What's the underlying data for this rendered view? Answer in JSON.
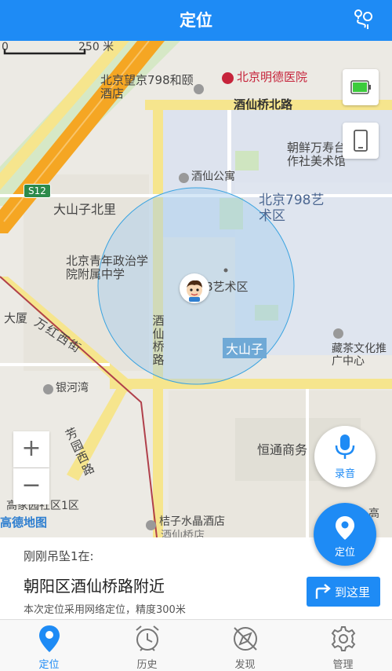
{
  "header": {
    "title": "定位",
    "route_icon": "route-pin-icon"
  },
  "map": {
    "scale_bar_label": "250 米",
    "scale_zero": "0",
    "labels": {
      "hotel_798": "北京望京798和颐酒店",
      "hospital": "北京明德医院",
      "jiuxianqiao_north_rd": "酒仙桥北路",
      "chaoxian_art": "朝鲜万寿台创作社美术馆",
      "jiuxian_apartment": "酒仙公寓",
      "s12": "S12",
      "dashanzi_north": "大山子北里",
      "art_798": "北京798艺术区",
      "art_798_partial": "8艺术区",
      "youth_college": "北京青年政治学院附属中学",
      "dasha": "大厦",
      "wanhong_west": "万红西街",
      "jiuxianqiao_rd": "酒仙桥路",
      "dashanzi": "大山子",
      "cang_cha": "藏茶文化推广中心",
      "yinhewan": "银河湾",
      "fangyuan_west": "芳园西路",
      "hengtong": "恒通商务",
      "gaojia_garden": "高家园社区1区",
      "gaode": "高德地图",
      "juzi_hotel": "桔子水晶酒店",
      "juzi_sub": "酒仙桥店",
      "gao_partial": "高"
    },
    "zoom_in": "+",
    "zoom_out": "−",
    "battery_icon": "battery-icon",
    "phone_icon": "phone-icon"
  },
  "record_button": {
    "label": "录音",
    "icon": "microphone-icon"
  },
  "locate_button": {
    "label": "定位",
    "icon": "location-pin-icon"
  },
  "panel": {
    "status": "刚刚吊坠1在:",
    "address": "朝阳区酒仙桥路附近",
    "note": "本次定位采用网络定位，精度300米",
    "goto_label": "到这里"
  },
  "tabs": [
    {
      "label": "定位",
      "icon": "location-pin-icon",
      "active": true
    },
    {
      "label": "历史",
      "icon": "alarm-clock-icon",
      "active": false
    },
    {
      "label": "发现",
      "icon": "compass-icon",
      "active": false
    },
    {
      "label": "管理",
      "icon": "gear-icon",
      "active": false
    }
  ],
  "colors": {
    "accent": "#1e8bf5",
    "major_road": "#f5a623",
    "road_yellow": "#f6e58d",
    "hospital_red": "#c6243b"
  }
}
